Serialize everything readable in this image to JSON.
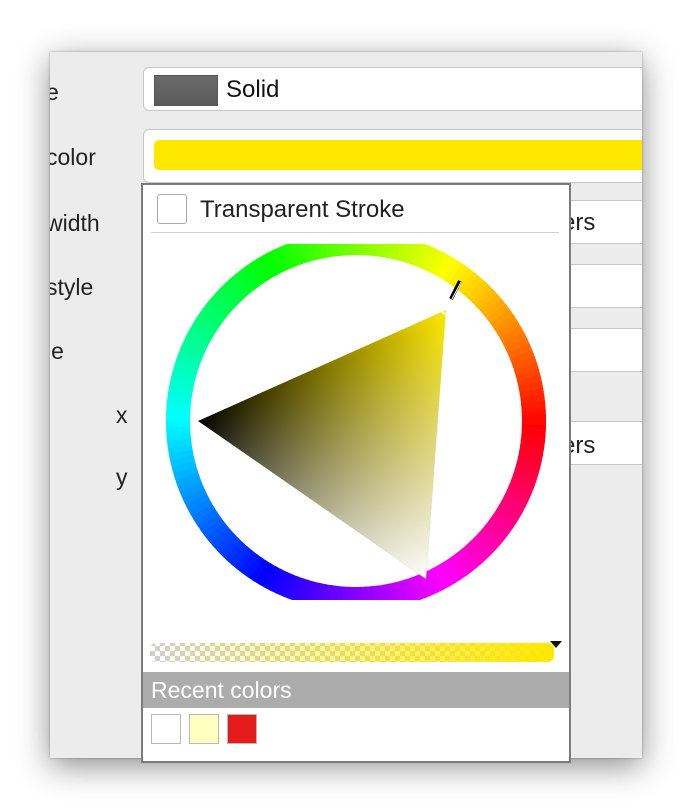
{
  "labels": {
    "row1": "e",
    "row2": "color",
    "row3": "width",
    "row4": "style",
    "row5": "le",
    "x": "x",
    "y": "y"
  },
  "fill": {
    "style_label": "Solid",
    "swatch_color": "#626262"
  },
  "stroke": {
    "color": "#ffe800"
  },
  "units": {
    "width_units": "ers",
    "offset_units": "ers"
  },
  "picker": {
    "transparent_label": "Transparent Stroke",
    "transparent_checked": false,
    "recent_header": "Recent colors",
    "recent_colors": [
      "#ffffff",
      "#ffffc0",
      "#e31b1b"
    ],
    "current_color": "#ffe800",
    "alpha": 1.0
  }
}
